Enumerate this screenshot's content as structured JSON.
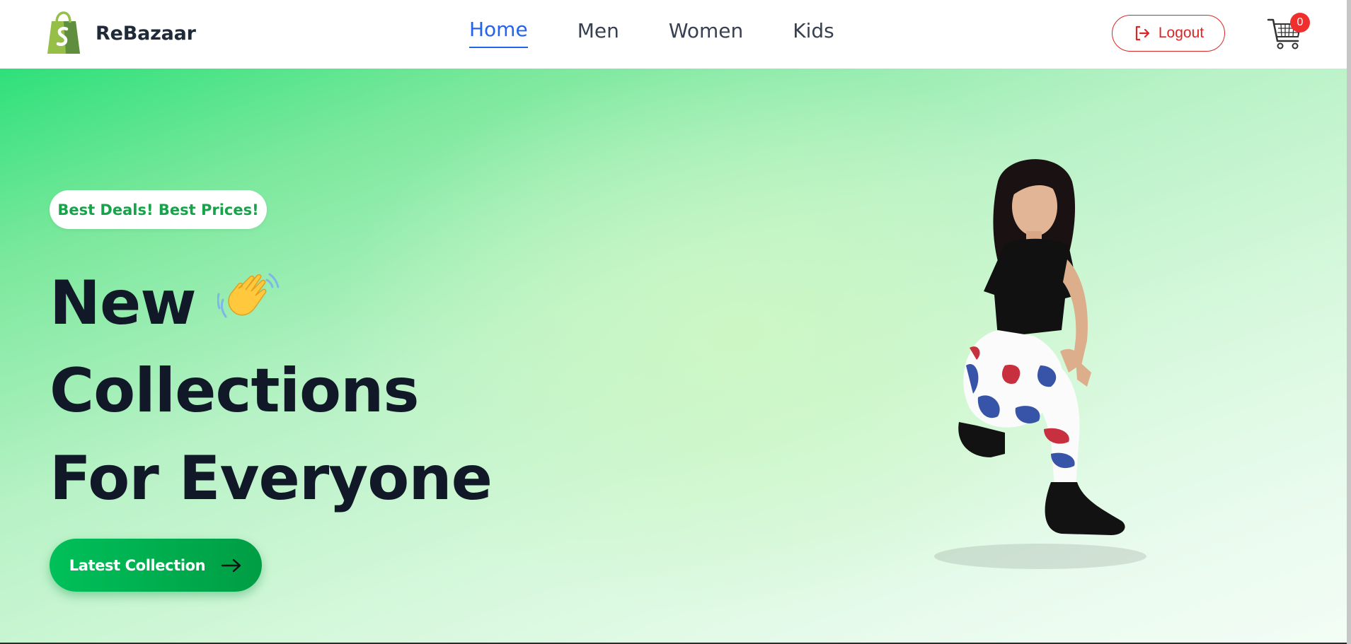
{
  "brand": {
    "name": "ReBazaar",
    "logo_icon": "shopping-bag-logo-icon"
  },
  "nav": {
    "links": [
      {
        "label": "Home",
        "active": true
      },
      {
        "label": "Men",
        "active": false
      },
      {
        "label": "Women",
        "active": false
      },
      {
        "label": "Kids",
        "active": false
      }
    ]
  },
  "header_actions": {
    "logout_label": "Logout",
    "logout_icon": "logout-icon",
    "cart_icon": "cart-icon",
    "cart_count": "0"
  },
  "hero": {
    "badge": "Best Deals! Best Prices!",
    "headline": {
      "line1": "New",
      "line2": "Collections",
      "line3": "For Everyone"
    },
    "wave_icon": "waving-hand-icon",
    "cta_label": "Latest Collection",
    "cta_icon": "arrow-right-icon",
    "image": "model-photo"
  },
  "colors": {
    "accent": "#2563eb",
    "brand_green": "#16a34a",
    "logout_red": "#dc2626",
    "cart_badge": "#ef2e2e",
    "heading": "#111827"
  }
}
